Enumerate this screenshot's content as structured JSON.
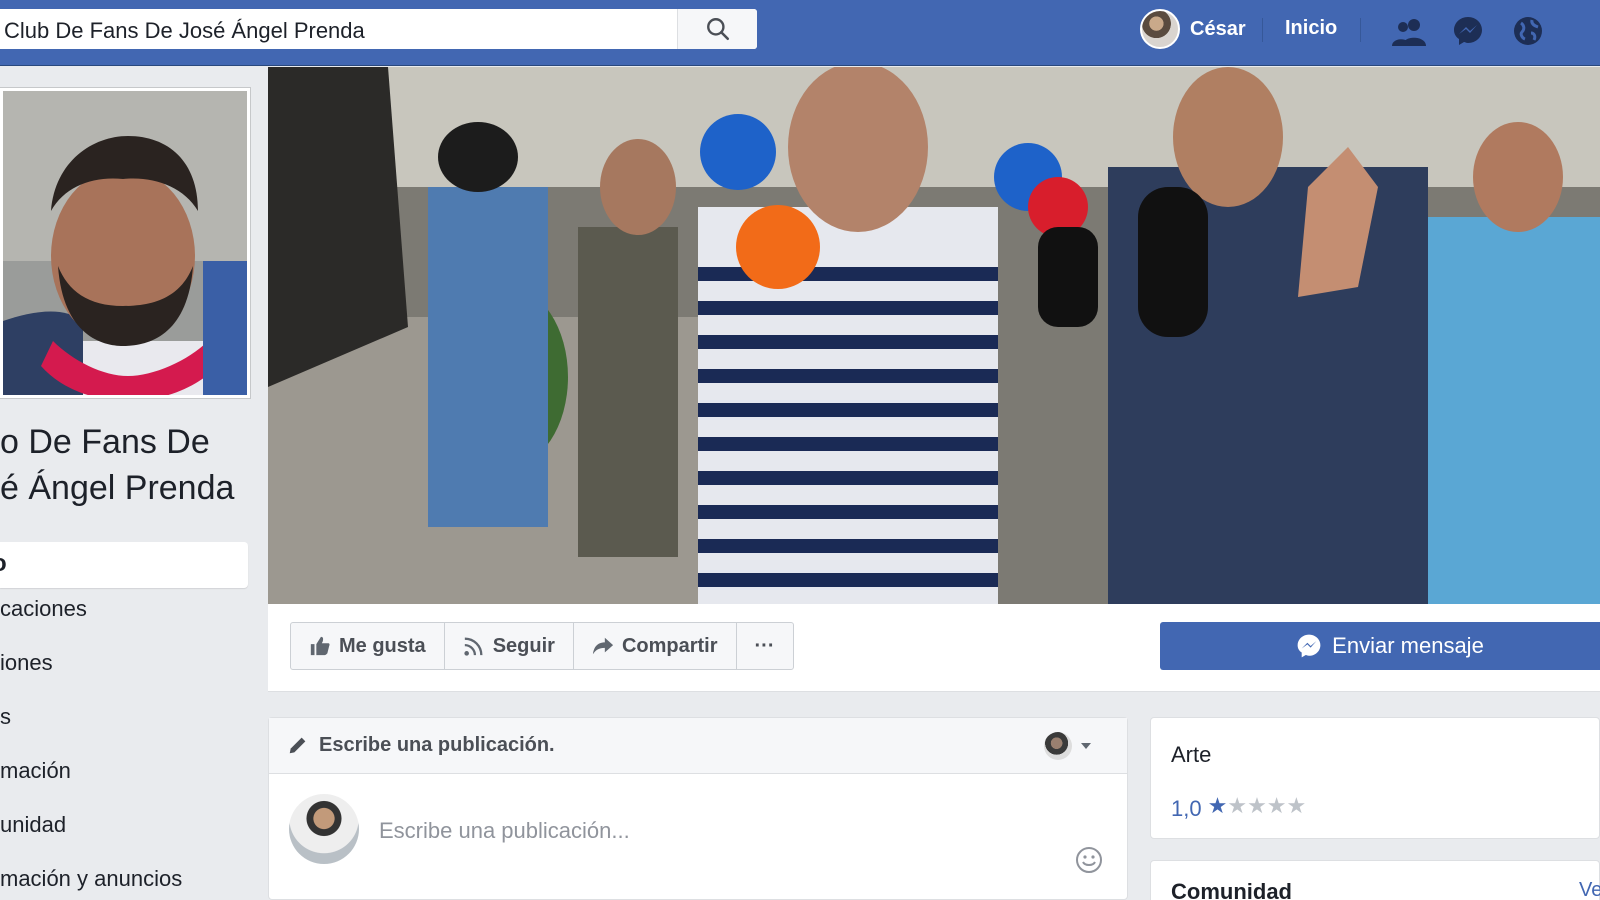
{
  "topbar": {
    "search_value": "Club De Fans De José Ángel Prenda",
    "user_name": "César",
    "home_label": "Inicio"
  },
  "page": {
    "title_line1": "o De Fans De",
    "title_line2": "é Ángel Prenda",
    "nav_active": "o",
    "nav_items": [
      "caciones",
      "iones",
      "s",
      "mación",
      "unidad",
      "mación y anuncios"
    ]
  },
  "actions": {
    "like": "Me gusta",
    "follow": "Seguir",
    "share": "Compartir",
    "more": "···",
    "message": "Enviar mensaje"
  },
  "composer": {
    "header": "Escribe una publicación.",
    "placeholder": "Escribe una publicación..."
  },
  "widgets": {
    "category": "Arte",
    "rating_value": "1,0",
    "rating_stars": 1,
    "rating_max": 5,
    "community_title": "Comunidad",
    "community_link": "Ve"
  },
  "colors": {
    "brand": "#4267b2",
    "star_filled": "#4267b2",
    "star_empty": "#bec3c9"
  }
}
